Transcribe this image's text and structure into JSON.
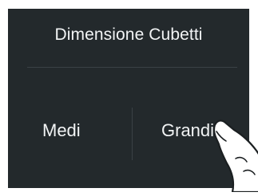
{
  "panel": {
    "title": "Dimensione Cubetti",
    "options": [
      {
        "label": "Medi"
      },
      {
        "label": "Grandi"
      }
    ]
  },
  "colors": {
    "panel_bg": "#23292c",
    "text": "#f2f4f5",
    "divider": "#3a4145",
    "hand_fill": "#ffffff",
    "hand_outline": "#1b1f21"
  },
  "icons": {
    "pointer": "hand-pointer-icon"
  }
}
